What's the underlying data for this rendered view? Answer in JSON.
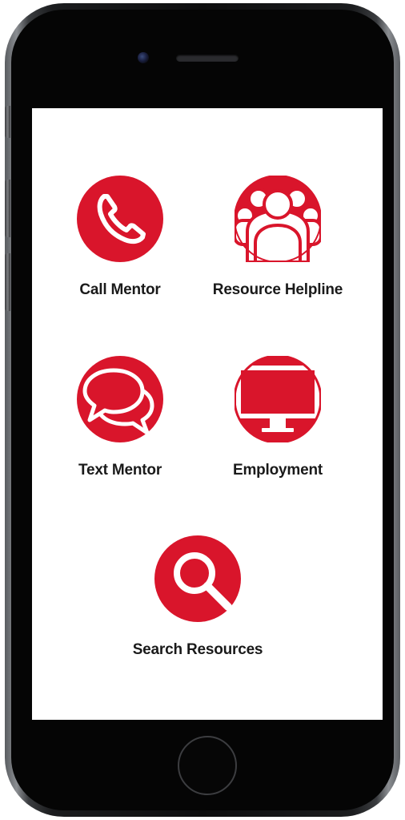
{
  "brand_color": "#d9152b",
  "tiles": [
    {
      "label": "Call Mentor",
      "icon": "phone-icon"
    },
    {
      "label": "Resource Helpline",
      "icon": "group-icon"
    },
    {
      "label": "Text Mentor",
      "icon": "chat-bubbles-icon"
    },
    {
      "label": "Employment",
      "icon": "computer-monitor-icon"
    },
    {
      "label": "Search Resources",
      "icon": "magnifier-icon"
    }
  ]
}
